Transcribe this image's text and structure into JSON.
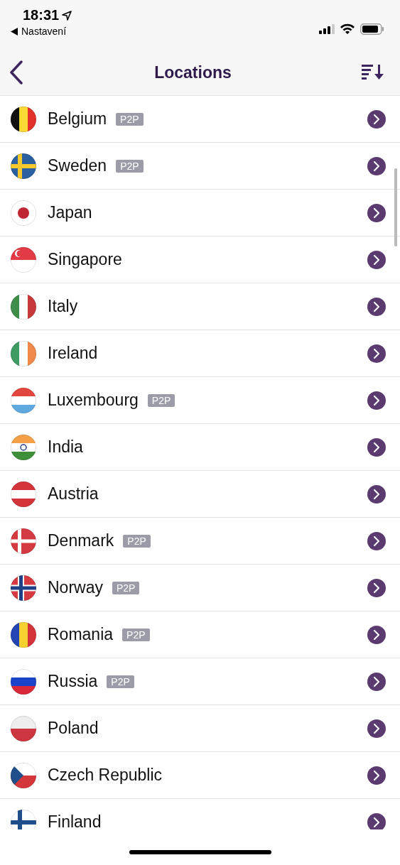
{
  "status_bar": {
    "time": "18:31",
    "back_app": "Nastavení"
  },
  "nav": {
    "title": "Locations"
  },
  "locations": [
    {
      "name": "Belgium",
      "kind": "be",
      "badge": "P2P"
    },
    {
      "name": "Sweden",
      "kind": "se",
      "badge": "P2P"
    },
    {
      "name": "Japan",
      "kind": "jp"
    },
    {
      "name": "Singapore",
      "kind": "sg"
    },
    {
      "name": "Italy",
      "kind": "it"
    },
    {
      "name": "Ireland",
      "kind": "ie"
    },
    {
      "name": "Luxembourg",
      "kind": "lu",
      "badge": "P2P"
    },
    {
      "name": "India",
      "kind": "in"
    },
    {
      "name": "Austria",
      "kind": "at"
    },
    {
      "name": "Denmark",
      "kind": "dk",
      "badge": "P2P"
    },
    {
      "name": "Norway",
      "kind": "no",
      "badge": "P2P"
    },
    {
      "name": "Romania",
      "kind": "ro",
      "badge": "P2P"
    },
    {
      "name": "Russia",
      "kind": "ru",
      "badge": "P2P"
    },
    {
      "name": "Poland",
      "kind": "pl"
    },
    {
      "name": "Czech Republic",
      "kind": "cz"
    },
    {
      "name": "Finland",
      "kind": "fi"
    }
  ]
}
